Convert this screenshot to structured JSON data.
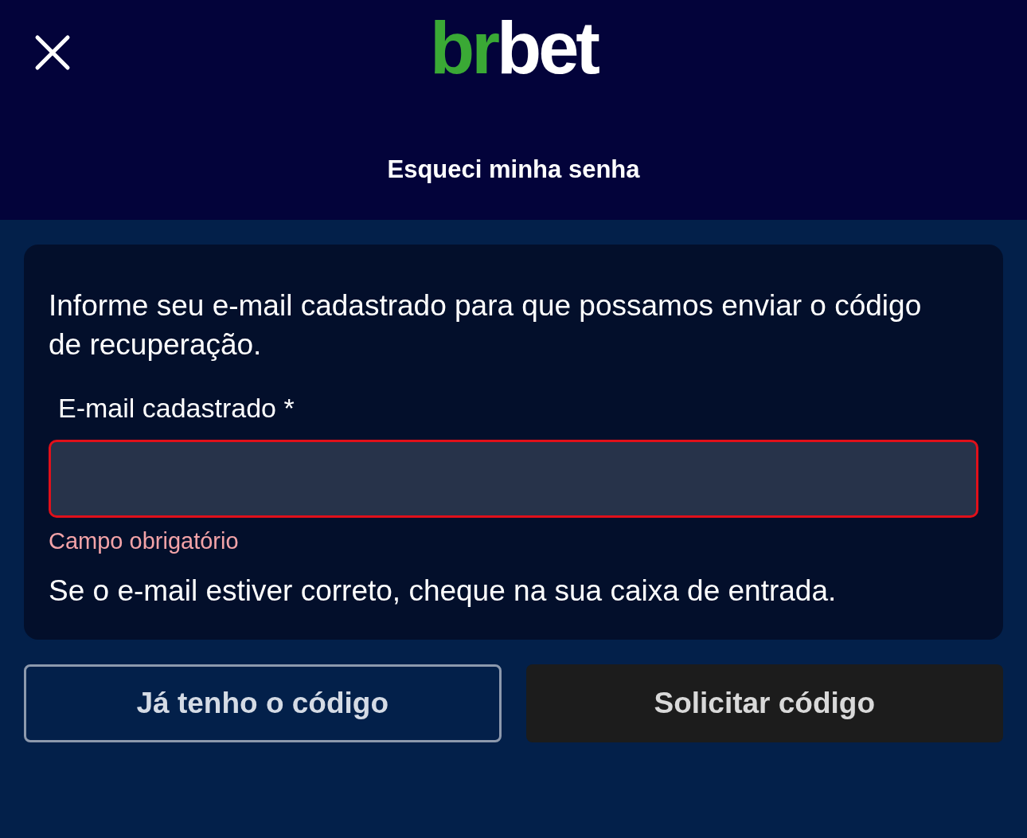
{
  "header": {
    "logo": [
      {
        "text": "br",
        "color": "#3aa935"
      },
      {
        "text": "bet",
        "color": "#ffffff"
      }
    ],
    "title": "Esqueci minha senha"
  },
  "card": {
    "intro": "Informe seu e-mail cadastrado para que possamos enviar o código de recuperação.",
    "field": {
      "label": "E-mail cadastrado *",
      "error": true,
      "error_text": "Campo obrigatório"
    },
    "note": "Se o e-mail estiver correto, cheque na sua caixa de entrada."
  },
  "buttons": [
    {
      "label": "Já tenho o código",
      "kind": "outline",
      "disabled": false
    },
    {
      "label": "Solicitar código",
      "kind": "solid",
      "disabled": true
    }
  ]
}
